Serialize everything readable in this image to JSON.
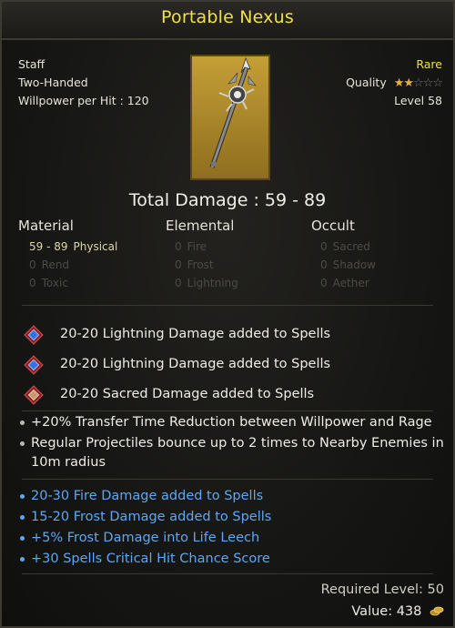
{
  "item": {
    "name": "Portable Nexus",
    "type": "Staff",
    "handedness": "Two-Handed",
    "willpower": "Willpower per Hit : 120",
    "rarity": "Rare",
    "quality_label": "Quality",
    "quality_stars": 2,
    "quality_max": 5,
    "level": "Level 58"
  },
  "damage": {
    "total": "Total Damage : 59 - 89",
    "categories": [
      "Material",
      "Elemental",
      "Occult"
    ],
    "stats": [
      [
        {
          "value": "59 - 89",
          "label": "Physical",
          "active": true
        },
        {
          "value": "0",
          "label": "Rend",
          "active": false
        },
        {
          "value": "0",
          "label": "Toxic",
          "active": false
        }
      ],
      [
        {
          "value": "0",
          "label": "Fire",
          "active": false
        },
        {
          "value": "0",
          "label": "Frost",
          "active": false
        },
        {
          "value": "0",
          "label": "Lightning",
          "active": false
        }
      ],
      [
        {
          "value": "0",
          "label": "Sacred",
          "active": false
        },
        {
          "value": "0",
          "label": "Shadow",
          "active": false
        },
        {
          "value": "0",
          "label": "Aether",
          "active": false
        }
      ]
    ]
  },
  "gem_affixes": [
    {
      "text": "20-20 Lightning Damage added to Spells",
      "gem": "blue-gem-icon",
      "color": "#2f73e8"
    },
    {
      "text": "20-20 Lightning Damage added to Spells",
      "gem": "blue-gem-icon",
      "color": "#2f73e8"
    },
    {
      "text": "20-20 Sacred Damage added to Spells",
      "gem": "tan-gem-icon",
      "color": "#c59a73"
    }
  ],
  "affixes": [
    "+20% Transfer Time Reduction between Willpower and Rage",
    "Regular Projectiles bounce up to 2 times to Nearby Enemies in",
    "10m radius"
  ],
  "magic_affixes": [
    "20-30 Fire Damage added to Spells",
    "15-20 Frost Damage added to Spells",
    "+5% Frost Damage into Life Leech",
    "+30 Spells Critical Hit Chance Score"
  ],
  "footer": {
    "required_level": "Required Level: 50",
    "value": "Value: 438"
  },
  "colors": {
    "rarity": "#f0e04a",
    "magic": "#5fa7f2",
    "accent_gold": "#c49f36"
  }
}
